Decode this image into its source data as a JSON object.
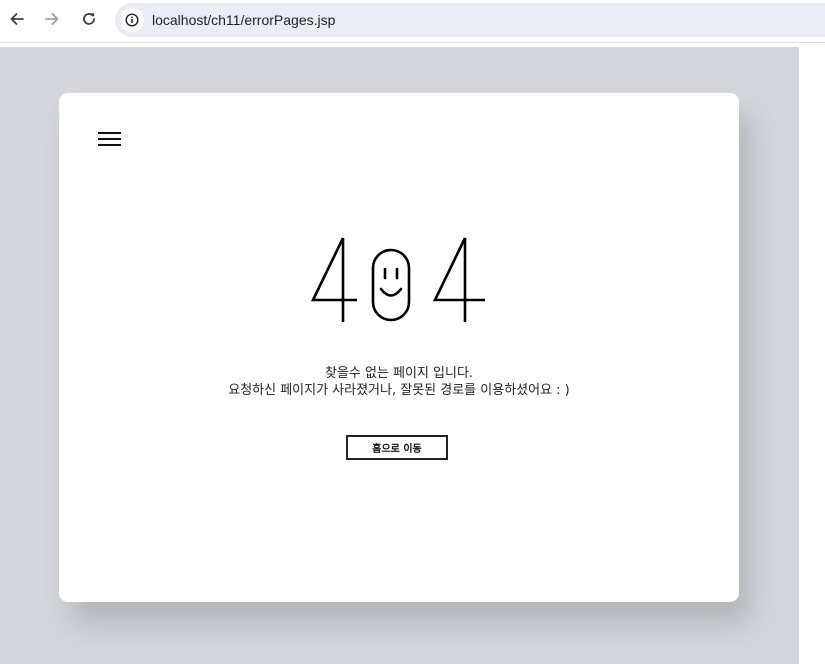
{
  "browser": {
    "url": "localhost/ch11/errorPages.jsp",
    "icons": {
      "back": "arrow-left-icon",
      "forward": "arrow-right-icon",
      "reload": "reload-icon",
      "site_info": "info-icon"
    }
  },
  "error_page": {
    "code": "404",
    "menu_icon": "hamburger-menu-icon",
    "message_line1": "찾을수 없는 페이지 입니다.",
    "message_line2": "요청하신 페이지가 사라졌거나, 잘못된 경로를 이용하셨어요 : )",
    "home_button_label": "홈으로 이동"
  },
  "colors": {
    "page_background": "#d5d6db",
    "card_background": "#ffffff",
    "text": "#222222",
    "omnibox": "#eaecf4"
  }
}
